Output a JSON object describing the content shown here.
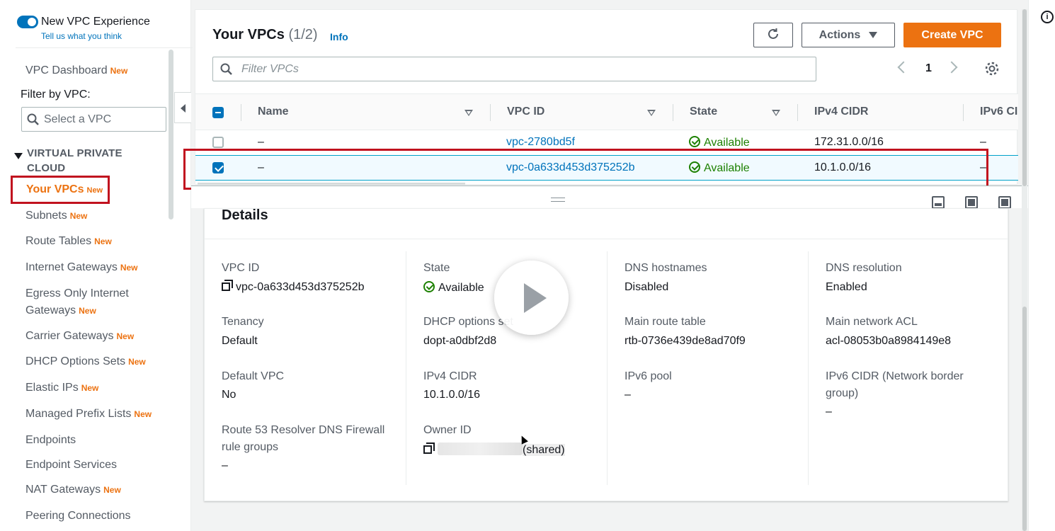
{
  "sidebar": {
    "toggle_label": "New VPC Experience",
    "toggle_link": "Tell us what you think",
    "dashboard": "VPC Dashboard",
    "new_badge": "New",
    "filter_label": "Filter by VPC:",
    "filter_placeholder": "Select a VPC",
    "section": "VIRTUAL PRIVATE CLOUD",
    "items": [
      {
        "label": "Your VPCs",
        "badge": "New"
      },
      {
        "label": "Subnets",
        "badge": "New"
      },
      {
        "label": "Route Tables",
        "badge": "New"
      },
      {
        "label": "Internet Gateways",
        "badge": "New"
      },
      {
        "label": "Egress Only Internet",
        "label2": "Gateways",
        "badge": "New"
      },
      {
        "label": "Carrier Gateways",
        "badge": "New"
      },
      {
        "label": "DHCP Options Sets",
        "badge": "New"
      },
      {
        "label": "Elastic IPs",
        "badge": "New"
      },
      {
        "label": "Managed Prefix Lists",
        "badge": "New"
      },
      {
        "label": "Endpoints"
      },
      {
        "label": "Endpoint Services"
      },
      {
        "label": "NAT Gateways",
        "badge": "New"
      },
      {
        "label": "Peering Connections"
      }
    ]
  },
  "table": {
    "title": "Your VPCs",
    "count": "(1/2)",
    "info": "Info",
    "actions_label": "Actions",
    "create_label": "Create VPC",
    "filter_placeholder": "Filter VPCs",
    "page": "1",
    "columns": [
      "Name",
      "VPC ID",
      "State",
      "IPv4 CIDR",
      "IPv6 CI"
    ],
    "rows": [
      {
        "name": "–",
        "vpc_id": "vpc-2780bd5f",
        "state": "Available",
        "cidr": "172.31.0.0/16",
        "ipv6": "–",
        "selected": false
      },
      {
        "name": "–",
        "vpc_id": "vpc-0a633d453d375252b",
        "state": "Available",
        "cidr": "10.1.0.0/16",
        "ipv6": "–",
        "selected": true
      }
    ]
  },
  "details": {
    "title": "Details",
    "col1": [
      {
        "label": "VPC ID",
        "value": "vpc-0a633d453d375252b"
      },
      {
        "label": "Tenancy",
        "value": "Default"
      },
      {
        "label": "Default VPC",
        "value": "No"
      },
      {
        "label": "Route 53 Resolver DNS Firewall rule groups",
        "value": "–"
      }
    ],
    "col2": [
      {
        "label": "State",
        "value": "Available"
      },
      {
        "label": "DHCP options set",
        "value": "dopt-a0dbf2d8"
      },
      {
        "label": "IPv4 CIDR",
        "value": "10.1.0.0/16"
      },
      {
        "label": "Owner ID",
        "value": "(shared)"
      }
    ],
    "col3": [
      {
        "label": "DNS hostnames",
        "value": "Disabled"
      },
      {
        "label": "Main route table",
        "value": "rtb-0736e439de8ad70f9"
      },
      {
        "label": "IPv6 pool",
        "value": "–"
      }
    ],
    "col4": [
      {
        "label": "DNS resolution",
        "value": "Enabled"
      },
      {
        "label": "Main network ACL",
        "value": "acl-08053b0a8984149e8"
      },
      {
        "label": "IPv6 CIDR (Network border group)",
        "value": "–"
      }
    ]
  },
  "colors": {
    "accent": "#ec7211",
    "link": "#0073bb",
    "success": "#1d8102",
    "annotation": "#c1121f"
  }
}
